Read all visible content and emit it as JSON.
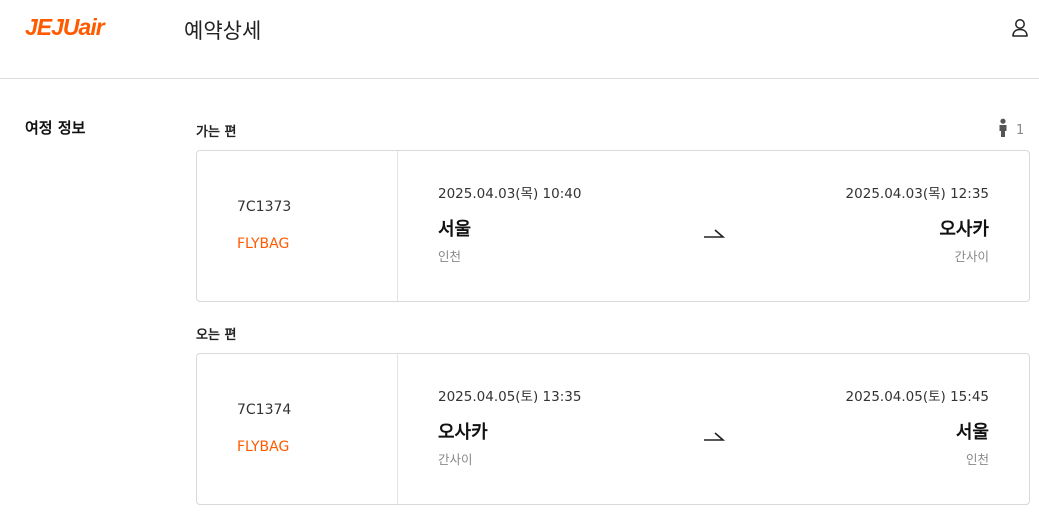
{
  "header": {
    "logo_text": "JEJUair",
    "title": "예약상세",
    "user_icon": "user-icon"
  },
  "itinerary": {
    "section_label": "여정 정보",
    "passenger_count": "1",
    "passenger_icon": "person-icon",
    "outbound": {
      "label": "가는 편",
      "flight_no": "7C1373",
      "fare": "FLYBAG",
      "dep_datetime": "2025.04.03(목) 10:40",
      "arr_datetime": "2025.04.03(목) 12:35",
      "dep_city": "서울",
      "arr_city": "오사카",
      "dep_airport": "인천",
      "arr_airport": "간사이"
    },
    "inbound": {
      "label": "오는 편",
      "flight_no": "7C1374",
      "fare": "FLYBAG",
      "dep_datetime": "2025.04.05(토) 13:35",
      "arr_datetime": "2025.04.05(토) 15:45",
      "dep_city": "오사카",
      "arr_city": "서울",
      "dep_airport": "간사이",
      "arr_airport": "인천"
    }
  },
  "colors": {
    "brand": "#ff5a00",
    "muted": "#888888",
    "border": "#d9d9d9"
  }
}
